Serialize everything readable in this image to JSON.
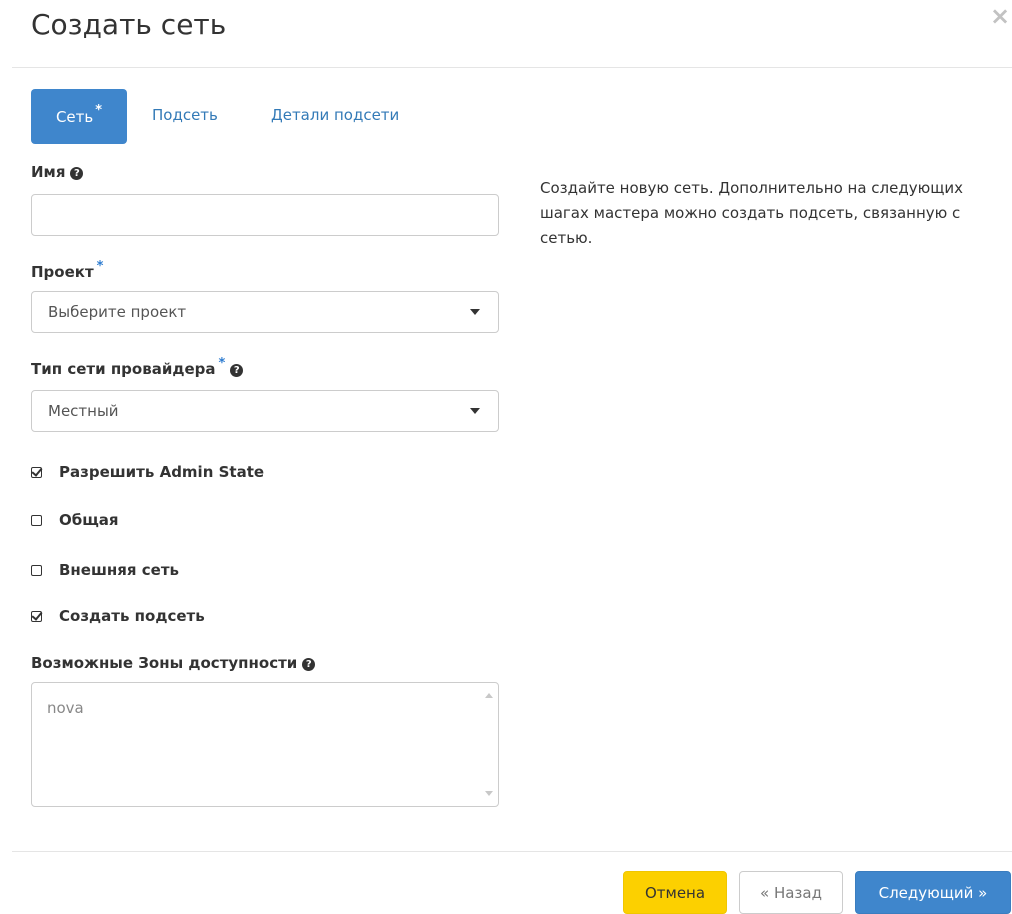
{
  "dialog": {
    "title": "Создать сеть",
    "close_icon": "×"
  },
  "tabs": [
    {
      "label": "Сеть",
      "active": true,
      "required": true
    },
    {
      "label": "Подсеть",
      "active": false
    },
    {
      "label": "Детали подсети",
      "active": false
    }
  ],
  "required_mark": "*",
  "help_icon": "?",
  "form": {
    "name": {
      "label": "Имя",
      "value": ""
    },
    "project": {
      "label": "Проект",
      "selected": "Выберите проект"
    },
    "provider_type": {
      "label": "Тип сети провайдера",
      "selected": "Местный"
    },
    "checkboxes": [
      {
        "label": "Разрешить Admin State",
        "checked": true
      },
      {
        "label": "Общая",
        "checked": false
      },
      {
        "label": "Внешняя сеть",
        "checked": false
      },
      {
        "label": "Создать подсеть",
        "checked": true
      }
    ],
    "availability_zones": {
      "label": "Возможные Зоны доступности",
      "options": [
        "nova"
      ]
    }
  },
  "help_text": "Создайте новую сеть. Дополнительно на следующих шагах мастера можно создать подсеть, связанную с сетью.",
  "footer": {
    "cancel": "Отмена",
    "back": "« Назад",
    "next": "Следующий »"
  },
  "colors": {
    "primary": "#3f86cc",
    "cancel": "#fcd000",
    "required": "#2e7cd0"
  }
}
